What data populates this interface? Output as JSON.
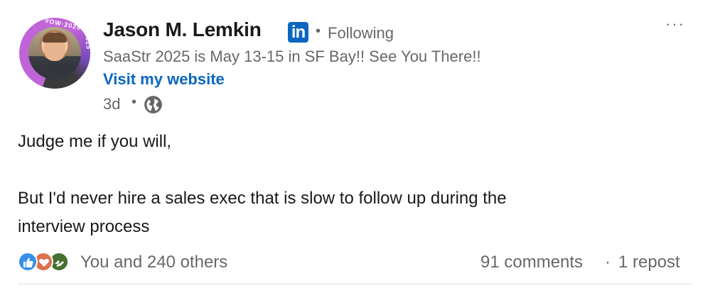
{
  "author": {
    "name": "Jason M. Lemkin",
    "badge_text": "in",
    "follow_status": "Following",
    "headline": "SaaStr 2025 is May 13-15 in SF Bay!! See You There!!",
    "website_link": "Visit my website",
    "avatar_ring_text_top": "#OW·2025",
    "avatar_ring_text_side": "#SAASTR2025"
  },
  "meta": {
    "time": "3d",
    "separator": "•",
    "visibility_icon": "globe-icon"
  },
  "more_label": "···",
  "post": {
    "lines": [
      "Judge me if you will,",
      "",
      "But I'd never hire a sales exec that is slow to follow up during the",
      "interview process"
    ]
  },
  "social": {
    "reaction_icons": [
      "like-icon",
      "love-icon",
      "support-icon"
    ],
    "reactions_text": "You and 240 others",
    "comments_text": "91 comments",
    "separator": "·",
    "reposts_text": "1 repost"
  },
  "colors": {
    "brand_blue": "#0a66c2",
    "muted_text": "rgba(0,0,0,0.6)",
    "like": "#378fe9",
    "love": "#df704d",
    "support": "#44712e"
  }
}
